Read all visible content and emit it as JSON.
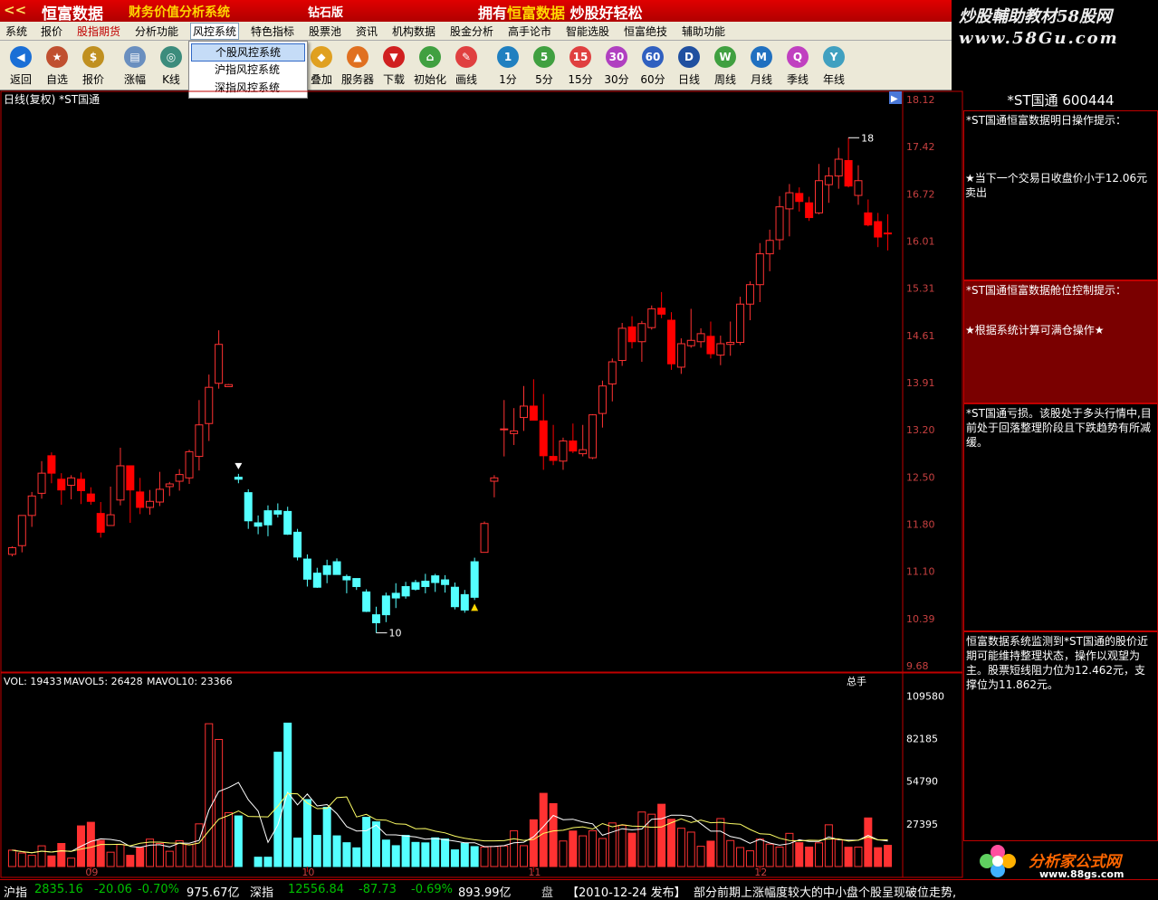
{
  "titlebar": {
    "logo": "<<",
    "brand": "恒富数据",
    "subtitle": "财务价值分析系统",
    "edition": "钻石版",
    "slogan_prefix": "拥有",
    "slogan_brand": "恒富数据",
    "slogan_suffix": "炒股好轻松"
  },
  "watermark": {
    "line1": "炒股輔助教材58股网",
    "line2": "www.58Gu.com"
  },
  "menu": [
    "系统",
    "报价",
    "股指期货",
    "分析功能",
    "风控系统",
    "特色指标",
    "股票池",
    "资讯",
    "机构数据",
    "股金分析",
    "高手论市",
    "智能选股",
    "恒富绝技",
    "辅助功能"
  ],
  "toolbar": [
    {
      "label": "返回",
      "icon": "back-icon",
      "color": "#1a6fd6",
      "glyph": "◀"
    },
    {
      "label": "自选",
      "icon": "favorites-icon",
      "color": "#c05030",
      "glyph": "★"
    },
    {
      "label": "报价",
      "icon": "quote-icon",
      "color": "#c09020",
      "glyph": "$"
    },
    {
      "label": "涨幅",
      "icon": "gain-icon",
      "color": "#6a8fbf",
      "glyph": "▤"
    },
    {
      "label": "K线",
      "icon": "kline-icon",
      "color": "#3c8c7c",
      "glyph": "◎"
    },
    {
      "label": "叠加",
      "icon": "overlay-icon",
      "color": "#e0a020",
      "glyph": "◆"
    },
    {
      "label": "服务器",
      "icon": "server-icon",
      "color": "#e07020",
      "glyph": "▲"
    },
    {
      "label": "下载",
      "icon": "download-icon",
      "color": "#d02020",
      "glyph": "▼"
    },
    {
      "label": "初始化",
      "icon": "home-icon",
      "color": "#40a040",
      "glyph": "⌂"
    },
    {
      "label": "画线",
      "icon": "draw-line-icon",
      "color": "#e04040",
      "glyph": "✎"
    },
    {
      "label": "1分",
      "icon": "period-1m-icon",
      "color": "#2080c0",
      "glyph": "1"
    },
    {
      "label": "5分",
      "icon": "period-5m-icon",
      "color": "#40a040",
      "glyph": "5"
    },
    {
      "label": "15分",
      "icon": "period-15m-icon",
      "color": "#e04040",
      "glyph": "15"
    },
    {
      "label": "30分",
      "icon": "period-30m-icon",
      "color": "#b040c0",
      "glyph": "30"
    },
    {
      "label": "60分",
      "icon": "period-60m-icon",
      "color": "#3060c0",
      "glyph": "60"
    },
    {
      "label": "日线",
      "icon": "daily-icon",
      "color": "#2050a0",
      "glyph": "D"
    },
    {
      "label": "周线",
      "icon": "weekly-icon",
      "color": "#40a040",
      "glyph": "W"
    },
    {
      "label": "月线",
      "icon": "monthly-icon",
      "color": "#2070c0",
      "glyph": "M"
    },
    {
      "label": "季线",
      "icon": "quarterly-icon",
      "color": "#c040c0",
      "glyph": "Q"
    },
    {
      "label": "年线",
      "icon": "yearly-icon",
      "color": "#40a0c0",
      "glyph": "Y"
    }
  ],
  "dropdown": {
    "items": [
      "个股风控系统",
      "沪指风控系统",
      "深指风控系统"
    ],
    "selected": 0
  },
  "chart_data": [
    {
      "type": "candlestick",
      "title": "日线(复权) *ST国通",
      "ylim": [
        9.68,
        18.12
      ],
      "y_ticks": [
        "18.12",
        "17.42",
        "16.72",
        "16.01",
        "15.31",
        "14.61",
        "13.91",
        "13.20",
        "12.50",
        "11.80",
        "11.10",
        "10.39",
        "9.68"
      ],
      "x_ticks": [
        "09",
        "10",
        "11",
        "12"
      ],
      "annotations": {
        "high_marker": "18",
        "low_marker": "10"
      },
      "bars": [
        {
          "o": 11.34,
          "h": 11.46,
          "l": 11.31,
          "c": 11.44
        },
        {
          "o": 11.47,
          "h": 11.88,
          "l": 11.37,
          "c": 11.92
        },
        {
          "o": 11.92,
          "h": 12.27,
          "l": 11.75,
          "c": 12.21
        },
        {
          "o": 12.25,
          "h": 12.73,
          "l": 12.17,
          "c": 12.55
        },
        {
          "o": 12.81,
          "h": 12.86,
          "l": 12.4,
          "c": 12.55
        },
        {
          "o": 12.46,
          "h": 12.55,
          "l": 12.08,
          "c": 12.3
        },
        {
          "o": 12.37,
          "h": 12.52,
          "l": 12.16,
          "c": 12.48
        },
        {
          "o": 12.46,
          "h": 12.56,
          "l": 12.09,
          "c": 12.29
        },
        {
          "o": 12.24,
          "h": 12.34,
          "l": 12.08,
          "c": 12.13
        },
        {
          "o": 11.95,
          "h": 12.12,
          "l": 11.59,
          "c": 11.67
        },
        {
          "o": 11.77,
          "h": 12.35,
          "l": 11.77,
          "c": 11.93
        },
        {
          "o": 12.15,
          "h": 12.93,
          "l": 12.07,
          "c": 12.66
        },
        {
          "o": 12.66,
          "h": 12.35,
          "l": 11.81,
          "c": 12.3
        },
        {
          "o": 12.27,
          "h": 12.48,
          "l": 11.94,
          "c": 12.04
        },
        {
          "o": 12.04,
          "h": 12.3,
          "l": 11.93,
          "c": 12.13
        },
        {
          "o": 12.12,
          "h": 12.57,
          "l": 12.06,
          "c": 12.31
        },
        {
          "o": 12.35,
          "h": 12.42,
          "l": 12.21,
          "c": 12.39
        },
        {
          "o": 12.43,
          "h": 12.61,
          "l": 12.29,
          "c": 12.53
        },
        {
          "o": 12.48,
          "h": 12.9,
          "l": 12.39,
          "c": 12.87
        },
        {
          "o": 12.8,
          "h": 13.64,
          "l": 12.59,
          "c": 13.27
        },
        {
          "o": 13.29,
          "h": 14.02,
          "l": 13.03,
          "c": 13.83
        },
        {
          "o": 13.89,
          "h": 14.68,
          "l": 13.81,
          "c": 14.47
        },
        {
          "o": 13.84,
          "h": 13.88,
          "l": 13.84,
          "c": 13.87
        },
        {
          "o": 12.46,
          "h": 12.54,
          "l": 12.4,
          "c": 12.49
        },
        {
          "o": 12.26,
          "h": 12.31,
          "l": 11.72,
          "c": 11.84
        },
        {
          "o": 11.81,
          "h": 11.92,
          "l": 11.64,
          "c": 11.76
        },
        {
          "o": 11.78,
          "h": 12.07,
          "l": 11.61,
          "c": 11.99
        },
        {
          "o": 11.99,
          "h": 12.1,
          "l": 11.89,
          "c": 11.94
        },
        {
          "o": 11.98,
          "h": 12.05,
          "l": 11.63,
          "c": 11.64
        },
        {
          "o": 11.67,
          "h": 11.72,
          "l": 11.25,
          "c": 11.3
        },
        {
          "o": 11.27,
          "h": 11.34,
          "l": 10.86,
          "c": 10.97
        },
        {
          "o": 10.85,
          "h": 11.14,
          "l": 10.84,
          "c": 11.06
        },
        {
          "o": 11.04,
          "h": 11.26,
          "l": 10.91,
          "c": 11.17
        },
        {
          "o": 11.23,
          "h": 11.28,
          "l": 11.04,
          "c": 11.04
        },
        {
          "o": 11.01,
          "h": 11.04,
          "l": 10.76,
          "c": 10.96
        },
        {
          "o": 10.98,
          "h": 10.98,
          "l": 10.81,
          "c": 10.86
        },
        {
          "o": 10.78,
          "h": 10.82,
          "l": 10.48,
          "c": 10.49
        },
        {
          "o": 10.44,
          "h": 10.56,
          "l": 10.17,
          "c": 10.32
        },
        {
          "o": 10.44,
          "h": 10.77,
          "l": 10.33,
          "c": 10.72
        },
        {
          "o": 10.76,
          "h": 10.91,
          "l": 10.54,
          "c": 10.69
        },
        {
          "o": 10.72,
          "h": 10.93,
          "l": 10.68,
          "c": 10.86
        },
        {
          "o": 10.92,
          "h": 10.96,
          "l": 10.8,
          "c": 10.82
        },
        {
          "o": 10.86,
          "h": 11.05,
          "l": 10.76,
          "c": 10.94
        },
        {
          "o": 11.02,
          "h": 11.05,
          "l": 10.78,
          "c": 10.92
        },
        {
          "o": 10.96,
          "h": 11.03,
          "l": 10.77,
          "c": 10.89
        },
        {
          "o": 10.85,
          "h": 10.92,
          "l": 10.52,
          "c": 10.56
        },
        {
          "o": 10.51,
          "h": 10.81,
          "l": 10.47,
          "c": 10.74
        },
        {
          "o": 10.7,
          "h": 11.29,
          "l": 10.66,
          "c": 11.23
        },
        {
          "o": 11.37,
          "h": 11.83,
          "l": 11.37,
          "c": 11.8
        },
        {
          "o": 12.43,
          "h": 12.52,
          "l": 12.19,
          "c": 12.48
        },
        {
          "o": 13.2,
          "h": 13.64,
          "l": 12.8,
          "c": 13.21
        },
        {
          "o": 13.14,
          "h": 13.52,
          "l": 12.97,
          "c": 13.18
        },
        {
          "o": 13.38,
          "h": 13.85,
          "l": 13.18,
          "c": 13.55
        },
        {
          "o": 13.55,
          "h": 13.95,
          "l": 13.34,
          "c": 13.34
        },
        {
          "o": 13.33,
          "h": 13.73,
          "l": 12.6,
          "c": 12.81
        },
        {
          "o": 12.8,
          "h": 13.27,
          "l": 12.67,
          "c": 12.74
        },
        {
          "o": 12.73,
          "h": 13.08,
          "l": 12.6,
          "c": 13.03
        },
        {
          "o": 13.03,
          "h": 13.29,
          "l": 12.85,
          "c": 12.88
        },
        {
          "o": 12.84,
          "h": 13.27,
          "l": 12.8,
          "c": 12.9
        },
        {
          "o": 12.78,
          "h": 13.43,
          "l": 12.76,
          "c": 13.42
        },
        {
          "o": 13.44,
          "h": 13.93,
          "l": 13.23,
          "c": 13.85
        },
        {
          "o": 13.88,
          "h": 14.26,
          "l": 13.62,
          "c": 14.21
        },
        {
          "o": 14.23,
          "h": 14.79,
          "l": 14.15,
          "c": 14.71
        },
        {
          "o": 14.73,
          "h": 14.89,
          "l": 14.41,
          "c": 14.51
        },
        {
          "o": 14.51,
          "h": 14.82,
          "l": 14.21,
          "c": 14.78
        },
        {
          "o": 14.72,
          "h": 15.05,
          "l": 14.69,
          "c": 15.0
        },
        {
          "o": 15.01,
          "h": 15.25,
          "l": 14.86,
          "c": 14.92
        },
        {
          "o": 14.83,
          "h": 14.95,
          "l": 14.09,
          "c": 14.18
        },
        {
          "o": 14.13,
          "h": 14.56,
          "l": 14.03,
          "c": 14.48
        },
        {
          "o": 14.45,
          "h": 15.0,
          "l": 14.42,
          "c": 14.53
        },
        {
          "o": 14.51,
          "h": 14.71,
          "l": 14.42,
          "c": 14.63
        },
        {
          "o": 14.59,
          "h": 14.81,
          "l": 14.26,
          "c": 14.33
        },
        {
          "o": 14.31,
          "h": 14.6,
          "l": 14.16,
          "c": 14.48
        },
        {
          "o": 14.47,
          "h": 14.81,
          "l": 14.3,
          "c": 14.5
        },
        {
          "o": 14.5,
          "h": 15.18,
          "l": 14.46,
          "c": 15.07
        },
        {
          "o": 15.07,
          "h": 15.41,
          "l": 14.83,
          "c": 15.36
        },
        {
          "o": 15.36,
          "h": 15.98,
          "l": 15.1,
          "c": 15.82
        },
        {
          "o": 15.82,
          "h": 16.18,
          "l": 15.56,
          "c": 16.02
        },
        {
          "o": 16.03,
          "h": 16.68,
          "l": 15.88,
          "c": 16.52
        },
        {
          "o": 16.49,
          "h": 16.86,
          "l": 16.08,
          "c": 16.73
        },
        {
          "o": 16.72,
          "h": 16.81,
          "l": 16.45,
          "c": 16.6
        },
        {
          "o": 16.58,
          "h": 16.67,
          "l": 16.31,
          "c": 16.36
        },
        {
          "o": 16.43,
          "h": 17.16,
          "l": 16.41,
          "c": 16.91
        },
        {
          "o": 16.85,
          "h": 17.11,
          "l": 16.58,
          "c": 16.98
        },
        {
          "o": 16.98,
          "h": 17.4,
          "l": 16.79,
          "c": 17.23
        },
        {
          "o": 17.21,
          "h": 17.55,
          "l": 16.81,
          "c": 16.83
        },
        {
          "o": 16.69,
          "h": 17.14,
          "l": 16.55,
          "c": 16.91
        },
        {
          "o": 16.43,
          "h": 16.63,
          "l": 16.23,
          "c": 16.25
        },
        {
          "o": 16.3,
          "h": 16.43,
          "l": 15.92,
          "c": 16.07
        },
        {
          "o": 16.13,
          "h": 16.41,
          "l": 15.87,
          "c": 16.12
        }
      ],
      "colors": {
        "up": "#ff3232",
        "down": "#ff0000",
        "risk_up": "#54ffff",
        "risk_down": "#54ffff"
      }
    },
    {
      "type": "bar",
      "title": "VOL",
      "legend": {
        "vol_label": "VOL: 19433",
        "mavol5_label": "MAVOL5: 26428",
        "mavol10_label": "MAVOL10: 23366",
        "unit": "总手"
      },
      "ylim": [
        0,
        115000
      ],
      "y_ticks": [
        "109580",
        "82185",
        "54790",
        "27395"
      ],
      "values": [
        10500,
        8700,
        7200,
        13300,
        6800,
        14800,
        5400,
        26100,
        28400,
        16800,
        9200,
        14100,
        7200,
        12100,
        17600,
        14800,
        9800,
        16600,
        14100,
        27400,
        91700,
        81600,
        34600,
        32500,
        0,
        6000,
        6000,
        73400,
        92100,
        18300,
        43000,
        20000,
        38000,
        19700,
        15300,
        12000,
        31600,
        28700,
        17000,
        13400,
        20000,
        15500,
        15200,
        18400,
        17700,
        10700,
        14900,
        12800,
        12500,
        12900,
        13200,
        23000,
        13400,
        30000,
        47000,
        40400,
        16400,
        22800,
        19700,
        23000,
        18000,
        28000,
        26500,
        21400,
        35000,
        33600,
        40000,
        30400,
        24600,
        22100,
        13000,
        16300,
        30800,
        16700,
        12200,
        10100,
        17600,
        14400,
        12500,
        21300,
        15300,
        12500,
        15200,
        26800,
        17300,
        12400,
        12500,
        31200,
        12100,
        13600,
        23700,
        25000,
        14600
      ],
      "ma5": [
        10500,
        9600,
        8800,
        9900,
        9300,
        10100,
        9700,
        13000,
        16100,
        17800,
        17400,
        16400,
        12900,
        12300,
        13700,
        14000,
        12600,
        15100,
        15000,
        16800,
        36300,
        48200,
        50700,
        54000,
        42900,
        35600,
        15500,
        26600,
        47600,
        39600,
        46600,
        38900,
        39800,
        34000,
        25700,
        22800,
        23000,
        26600,
        20400,
        20300,
        19600,
        19000,
        17600,
        18000,
        17200,
        16300,
        15300,
        15300,
        12800,
        12900,
        13400,
        15200,
        15600,
        19100,
        25700,
        32800,
        30100,
        30400,
        28600,
        27400,
        20100,
        22200,
        24300,
        23500,
        24100,
        30400,
        30700,
        33000,
        33000,
        32200,
        27500,
        22700,
        22700,
        19300,
        18000,
        14900,
        17500,
        15100,
        13700,
        14700,
        17200,
        16100,
        16100,
        19000,
        17300,
        16900,
        16900,
        20000,
        17200,
        16400,
        18600,
        21100,
        21400
      ],
      "ma10": [
        10500,
        9600,
        8800,
        9900,
        9300,
        10100,
        9700,
        11200,
        12400,
        14200,
        14200,
        14300,
        13300,
        14900,
        15700,
        15700,
        15100,
        15000,
        13900,
        15100,
        23000,
        30400,
        32800,
        35700,
        32200,
        32000,
        31900,
        38700,
        46900,
        46700,
        40800,
        37200,
        37400,
        44200,
        44700,
        31800,
        33500,
        30000,
        29800,
        27400,
        27100,
        24300,
        24400,
        22700,
        21600,
        19500,
        18100,
        17200,
        16500,
        16500,
        16600,
        17900,
        16800,
        17400,
        21300,
        22900,
        23300,
        24900,
        25500,
        24100,
        27600,
        25500,
        26900,
        26000,
        25800,
        25200,
        25400,
        28100,
        30600,
        28300,
        29800,
        28100,
        28400,
        27600,
        27200,
        23800,
        21000,
        20700,
        18200,
        16700,
        16500,
        16900,
        16800,
        17800,
        17700,
        16300,
        16900,
        19000,
        17100,
        17200,
        18800,
        18700,
        18800
      ]
    }
  ],
  "chart_header": {
    "title": "日线(复权)  *ST国通"
  },
  "volume_axis_x": [
    "09",
    "10",
    "11",
    "12"
  ],
  "info": {
    "header": "*ST国通  600444",
    "box1_title": "*ST国通恒富数据明日操作提示：",
    "box1_text": "★当下一个交易日收盘价小于12.06元卖出",
    "box2_title": "*ST国通恒富数据舱位控制提示：",
    "box2_text": "★根据系统计算可满仓操作★",
    "box3_text": "*ST国通亏损。该股处于多头行情中,目前处于回落整理阶段且下跌趋势有所减缓。",
    "box4_text": "恒富数据系统监测到*ST国通的股价近期可能维持整理状态，操作以观望为主。股票短线阻力位为12.462元，支撑位为11.862元。"
  },
  "statusbar": {
    "sh_name": "沪指",
    "sh_value": "2835.16",
    "sh_change": "-20.06",
    "sh_pct": "-0.70%",
    "sh_amount": "975.67亿",
    "sz_name": "深指",
    "sz_value": "12556.84",
    "sz_change": "-87.73",
    "sz_pct": "-0.69%",
    "sz_amount": "893.99亿",
    "news_prefix": "盘",
    "news_date": "【2010-12-24 发布】",
    "news_text": "部分前期上涨幅度较大的中小盘个股呈现破位走势,"
  },
  "logo88": {
    "title": "分析家公式网",
    "url": "www.88gs.com"
  }
}
